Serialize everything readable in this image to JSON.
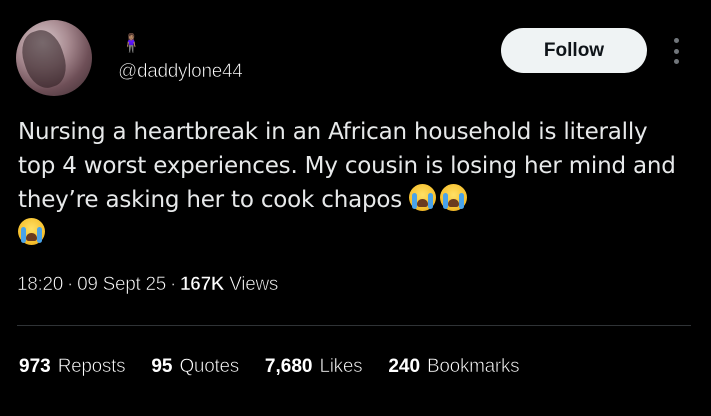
{
  "author": {
    "handle": "@daddylone44",
    "name_emoji": "🧍🏽‍♀️"
  },
  "header": {
    "follow_label": "Follow"
  },
  "tweet": {
    "text_line1": "Nursing a heartbreak in an African household is literally top 4 worst experiences. My cousin is losing her mind and they’re asking her to cook chapos "
  },
  "meta": {
    "time": "18:20",
    "date": "09 Sept 25",
    "separator": "·",
    "views_count": "167K",
    "views_label": "Views"
  },
  "stats": [
    {
      "count": "973",
      "label": "Reposts"
    },
    {
      "count": "95",
      "label": "Quotes"
    },
    {
      "count": "7,680",
      "label": "Likes"
    },
    {
      "count": "240",
      "label": "Bookmarks"
    }
  ],
  "colors": {
    "background": "#000000",
    "text": "#e7e9ea",
    "follow_button_bg": "#eff3f4",
    "divider": "#2f3336",
    "more_icon": "#71767b"
  },
  "icons": {
    "more": "more-dots-icon",
    "crying": "loudly-crying-face-icon"
  }
}
